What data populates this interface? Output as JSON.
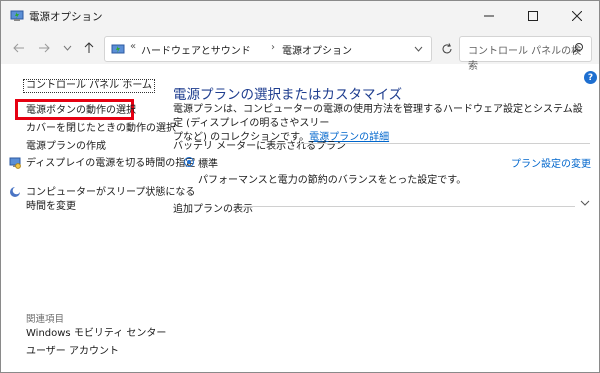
{
  "window": {
    "title": "電源オプション"
  },
  "address": {
    "overflow": "«",
    "crumbs": [
      "ハードウェアとサウンド",
      "電源オプション"
    ],
    "arrow": "›"
  },
  "search": {
    "placeholder": "コントロール パネルの検索"
  },
  "help": {
    "label": "?"
  },
  "sidebar": {
    "home": "コントロール パネル ホーム",
    "items": [
      "電源ボタンの動作の選択",
      "カバーを閉じたときの動作の選択",
      "電源プランの作成",
      "ディスプレイの電源を切る時間の指定",
      "コンピューターがスリープ状態になる",
      "時間を変更"
    ],
    "related_heading": "関連項目",
    "related": [
      "Windows モビリティ センター",
      "ユーザー アカウント"
    ]
  },
  "main": {
    "title": "電源プランの選択またはカスタマイズ",
    "intro_line1": "電源プランは、コンピューターの電源の使用方法を管理するハードウェア設定とシステム設定 (ディスプレイの明るさやスリー",
    "intro_line2": "プなど) のコレクションです。",
    "intro_link": "電源プランの詳細",
    "group_label": "バッテリ メーターに表示されるプラン",
    "plan": {
      "name": "標準",
      "description": "パフォーマンスと電力の節約のバランスをとった設定です。",
      "settings_link": "プラン設定の変更",
      "selected": true
    },
    "more_plans": "追加プランの表示"
  },
  "colors": {
    "accent": "#1e6fd0",
    "link": "#0066cc",
    "title": "#1e3d8f",
    "highlight": "#e60012"
  }
}
